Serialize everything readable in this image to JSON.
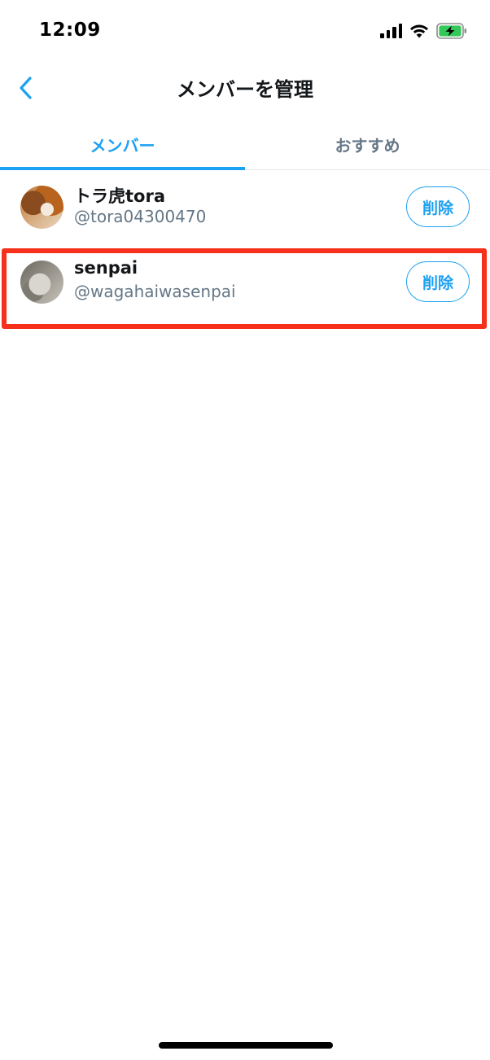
{
  "status_bar": {
    "time": "12:09",
    "icons": [
      "signal-icon",
      "wifi-icon",
      "battery-charging-icon"
    ],
    "battery_color": "#34c759"
  },
  "nav": {
    "back_icon": "chevron-left-icon",
    "title": "メンバーを管理"
  },
  "tabs": [
    {
      "label": "メンバー",
      "active": true
    },
    {
      "label": "おすすめ",
      "active": false
    }
  ],
  "members": [
    {
      "name": "トラ虎tora",
      "handle": "@tora04300470",
      "action_label": "削除"
    },
    {
      "name": "senpai",
      "handle": "@wagahaiwasenpai",
      "action_label": "削除",
      "highlighted": true
    }
  ],
  "colors": {
    "accent": "#1da1f2",
    "secondary_text": "#657786",
    "highlight_border": "#f7301c"
  }
}
